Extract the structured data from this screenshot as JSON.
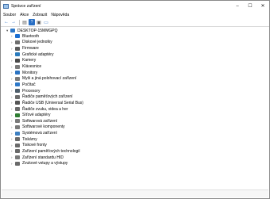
{
  "window": {
    "title": "Správce zařízení",
    "controls": {
      "minimize": "–",
      "maximize": "☐",
      "close": "✕"
    }
  },
  "menu": [
    "Soubor",
    "Akce",
    "Zobrazit",
    "Nápověda"
  ],
  "toolbar": {
    "back": "←",
    "forward": "→",
    "properties": "▤",
    "help": "?",
    "show_hidden": "▣",
    "monitor": "▭"
  },
  "tree": {
    "root": {
      "label": "DESKTOP-15MMGPQ",
      "icon": "computer-icon"
    },
    "items": [
      {
        "label": "Bluetooth",
        "icon": "bluetooth-icon",
        "color": "#1c6fd1"
      },
      {
        "label": "Diskové jednotky",
        "icon": "disk-icon",
        "color": "#6d6d6d"
      },
      {
        "label": "Firmware",
        "icon": "chip-icon",
        "color": "#5a5a5a"
      },
      {
        "label": "Grafické adaptéry",
        "icon": "display-adapter-icon",
        "color": "#2a7bbd"
      },
      {
        "label": "Kamery",
        "icon": "camera-icon",
        "color": "#4a4a4a"
      },
      {
        "label": "Klávesnice",
        "icon": "keyboard-icon",
        "color": "#7a7a7a"
      },
      {
        "label": "Monitory",
        "icon": "monitor-icon",
        "color": "#2b73c2"
      },
      {
        "label": "Myši a jiná polohovací zařízení",
        "icon": "mouse-icon",
        "color": "#7a7a7a"
      },
      {
        "label": "Počítač",
        "icon": "computer-icon",
        "color": "#2d78c8"
      },
      {
        "label": "Procesory",
        "icon": "processor-icon",
        "color": "#4f5e6b"
      },
      {
        "label": "Řadiče paměťových zařízení",
        "icon": "storage-controller-icon",
        "color": "#6b6b6b"
      },
      {
        "label": "Řadiče USB (Universal Serial Bus)",
        "icon": "usb-icon",
        "color": "#555555"
      },
      {
        "label": "Řadiče zvuku, videa a her",
        "icon": "speaker-icon",
        "color": "#6a6a6a"
      },
      {
        "label": "Síťové adaptéry",
        "icon": "network-icon",
        "color": "#2e7d32"
      },
      {
        "label": "Softwarová zařízení",
        "icon": "software-device-icon",
        "color": "#7a7a7a"
      },
      {
        "label": "Softwarové komponenty",
        "icon": "software-component-icon",
        "color": "#7a7a7a"
      },
      {
        "label": "Systémová zařízení",
        "icon": "system-device-icon",
        "color": "#3d7fc1"
      },
      {
        "label": "Tiskárny",
        "icon": "printer-icon",
        "color": "#6a6a6a"
      },
      {
        "label": "Tiskové fronty",
        "icon": "print-queue-icon",
        "color": "#6a6a6a"
      },
      {
        "label": "Zařízení paměťových technologií",
        "icon": "memory-device-icon",
        "color": "#6a6a6a"
      },
      {
        "label": "Zařízení standardu HID",
        "icon": "hid-icon",
        "color": "#7a7a7a"
      },
      {
        "label": "Zvukové vstupy a výstupy",
        "icon": "audio-io-icon",
        "color": "#6a6a6a"
      }
    ]
  }
}
